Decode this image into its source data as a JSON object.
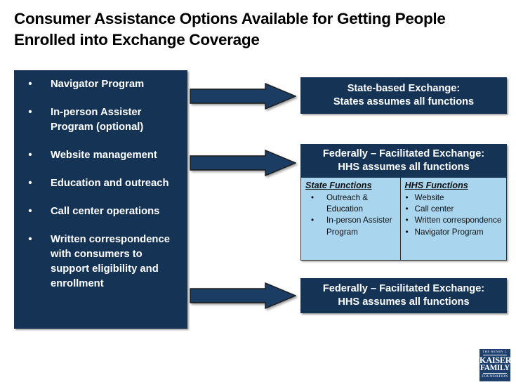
{
  "slide": {
    "title": "Consumer Assistance Options Available for Getting People Enrolled into Exchange Coverage"
  },
  "colors": {
    "navy": "#153355",
    "light_blue": "#a9d5ef",
    "logo_blue": "#1d3f6e",
    "text_white": "#ffffff",
    "text_black": "#000000"
  },
  "left_panel": {
    "bullet_glyph": "•",
    "items": [
      {
        "label": "Navigator Program"
      },
      {
        "label": "In-person Assister Program (optional)"
      },
      {
        "label": "Website management"
      },
      {
        "label": "Education and outreach"
      },
      {
        "label": "Call center operations"
      },
      {
        "label": "Written correspondence with consumers to support eligibility and enrollment"
      }
    ]
  },
  "arrows": [
    {
      "name": "arrow-to-state-based-exchange",
      "direction": "right"
    },
    {
      "name": "arrow-to-federally-facilitated-exchange-partnership",
      "direction": "right"
    },
    {
      "name": "arrow-to-federally-facilitated-exchange",
      "direction": "right"
    }
  ],
  "boxes": {
    "state_based": {
      "line1": "State-based Exchange:",
      "line2": "States assumes all functions"
    },
    "ffe_partnership": {
      "line1": "Federally – Facilitated Exchange:",
      "line2": "HHS assumes all functions"
    },
    "ffe_full": {
      "line1": "Federally – Facilitated Exchange:",
      "line2": "HHS assumes all functions"
    }
  },
  "functions_table": {
    "bullet_glyph": "•",
    "state": {
      "heading": "State Functions",
      "items": [
        "Outreach & Education",
        "In-person Assister Program"
      ]
    },
    "hhs": {
      "heading": "HHS Functions",
      "items": [
        "Website",
        "Call center",
        "Written correspondence",
        "Navigator Program"
      ]
    }
  },
  "logo": {
    "line1": "THE HENRY J.",
    "line2": "KAISER",
    "line3": "FAMILY",
    "line4": "FOUNDATION"
  }
}
